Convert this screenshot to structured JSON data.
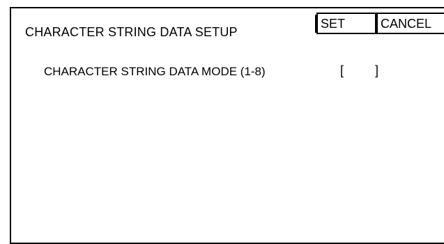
{
  "dialog": {
    "title": "CHARACTER STRING DATA SETUP",
    "set_label": "SET",
    "cancel_label": "CANCEL"
  },
  "field": {
    "label": "CHARACTER STRING DATA MODE (1-8)",
    "open_bracket": "[",
    "close_bracket": "]",
    "value": ""
  }
}
